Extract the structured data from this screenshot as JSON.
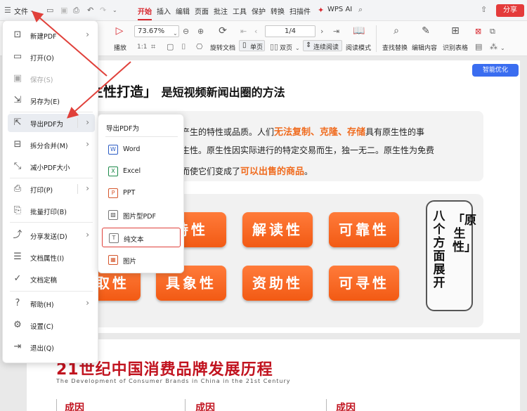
{
  "menubar": {
    "file_label": "文件",
    "tabs": [
      "开始",
      "插入",
      "编辑",
      "页面",
      "批注",
      "工具",
      "保护",
      "转换",
      "扫描件"
    ],
    "wps_ai": "WPS AI",
    "share": "分享"
  },
  "ribbon": {
    "play": "播放",
    "zoom_value": "73.67%",
    "page_value": "1/4",
    "rotate": "旋转文档",
    "single_page": "单页",
    "double_page": "双页",
    "continuous": "连续阅读",
    "read_mode": "阅读模式",
    "find_replace": "查找替换",
    "edit_content": "编辑内容",
    "recognize_table": "识别表格"
  },
  "smart_optimize": "智能优化",
  "file_menu": {
    "items": [
      {
        "label": "新建PDF",
        "icon": "new-pdf-icon",
        "arrow": true
      },
      {
        "label": "打开(O)",
        "icon": "open-folder-icon"
      },
      {
        "label": "保存(S)",
        "icon": "save-icon",
        "disabled": true
      },
      {
        "label": "另存为(E)",
        "icon": "save-as-icon"
      },
      {
        "label": "导出PDF为",
        "icon": "export-icon",
        "arrow": true,
        "highlighted": true
      },
      {
        "label": "拆分合并(M)",
        "icon": "split-merge-icon",
        "arrow": true
      },
      {
        "label": "减小PDF大小",
        "icon": "compress-icon"
      },
      {
        "label": "打印(P)",
        "icon": "print-icon",
        "arrow": true
      },
      {
        "label": "批量打印(B)",
        "icon": "batch-print-icon"
      },
      {
        "label": "分享发送(D)",
        "icon": "share-icon",
        "arrow": true
      },
      {
        "label": "文档属性(I)",
        "icon": "doc-properties-icon"
      },
      {
        "label": "文档定稿",
        "icon": "doc-finalize-icon"
      },
      {
        "label": "帮助(H)",
        "icon": "help-icon",
        "arrow": true
      },
      {
        "label": "设置(C)",
        "icon": "settings-icon"
      },
      {
        "label": "退出(Q)",
        "icon": "exit-icon"
      }
    ]
  },
  "export_submenu": {
    "title": "导出PDF为",
    "items": [
      {
        "label": "Word",
        "icon": "word-icon"
      },
      {
        "label": "Excel",
        "icon": "excel-icon"
      },
      {
        "label": "PPT",
        "icon": "ppt-icon"
      },
      {
        "label": "图片型PDF",
        "icon": "image-pdf-icon"
      },
      {
        "label": "纯文本",
        "icon": "plain-text-icon",
        "selected": true
      },
      {
        "label": "图片",
        "icon": "image-icon"
      }
    ]
  },
  "document": {
    "heading": "生性打造」",
    "heading_sub": "是短视频新闻出圈的方法",
    "para_line1_a": "产生的特性或品质。人们",
    "para_line1_hl": "无法复制、克隆、存储",
    "para_line1_b": "具有原生性的事",
    "para_line2": "生性。原生性因实际进行的特定交易而生，独一无二。原生性为免费",
    "para_line3_a": "而使它们变成了",
    "para_line3_hl": "可以出售的商品",
    "para_line3_b": "。",
    "buttons": [
      "特性",
      "解读性",
      "可靠性",
      "取性",
      "具象性",
      "资助性",
      "可寻性"
    ],
    "vertical_left": "八个方面展开",
    "vertical_right": "「原生性」",
    "red_title": "21世纪中国消费品牌发展历程",
    "red_subtitle": "The Development of Consumer Brands in China in the 21st Century",
    "red_tabs": [
      "成因",
      "成因",
      "成因"
    ]
  }
}
